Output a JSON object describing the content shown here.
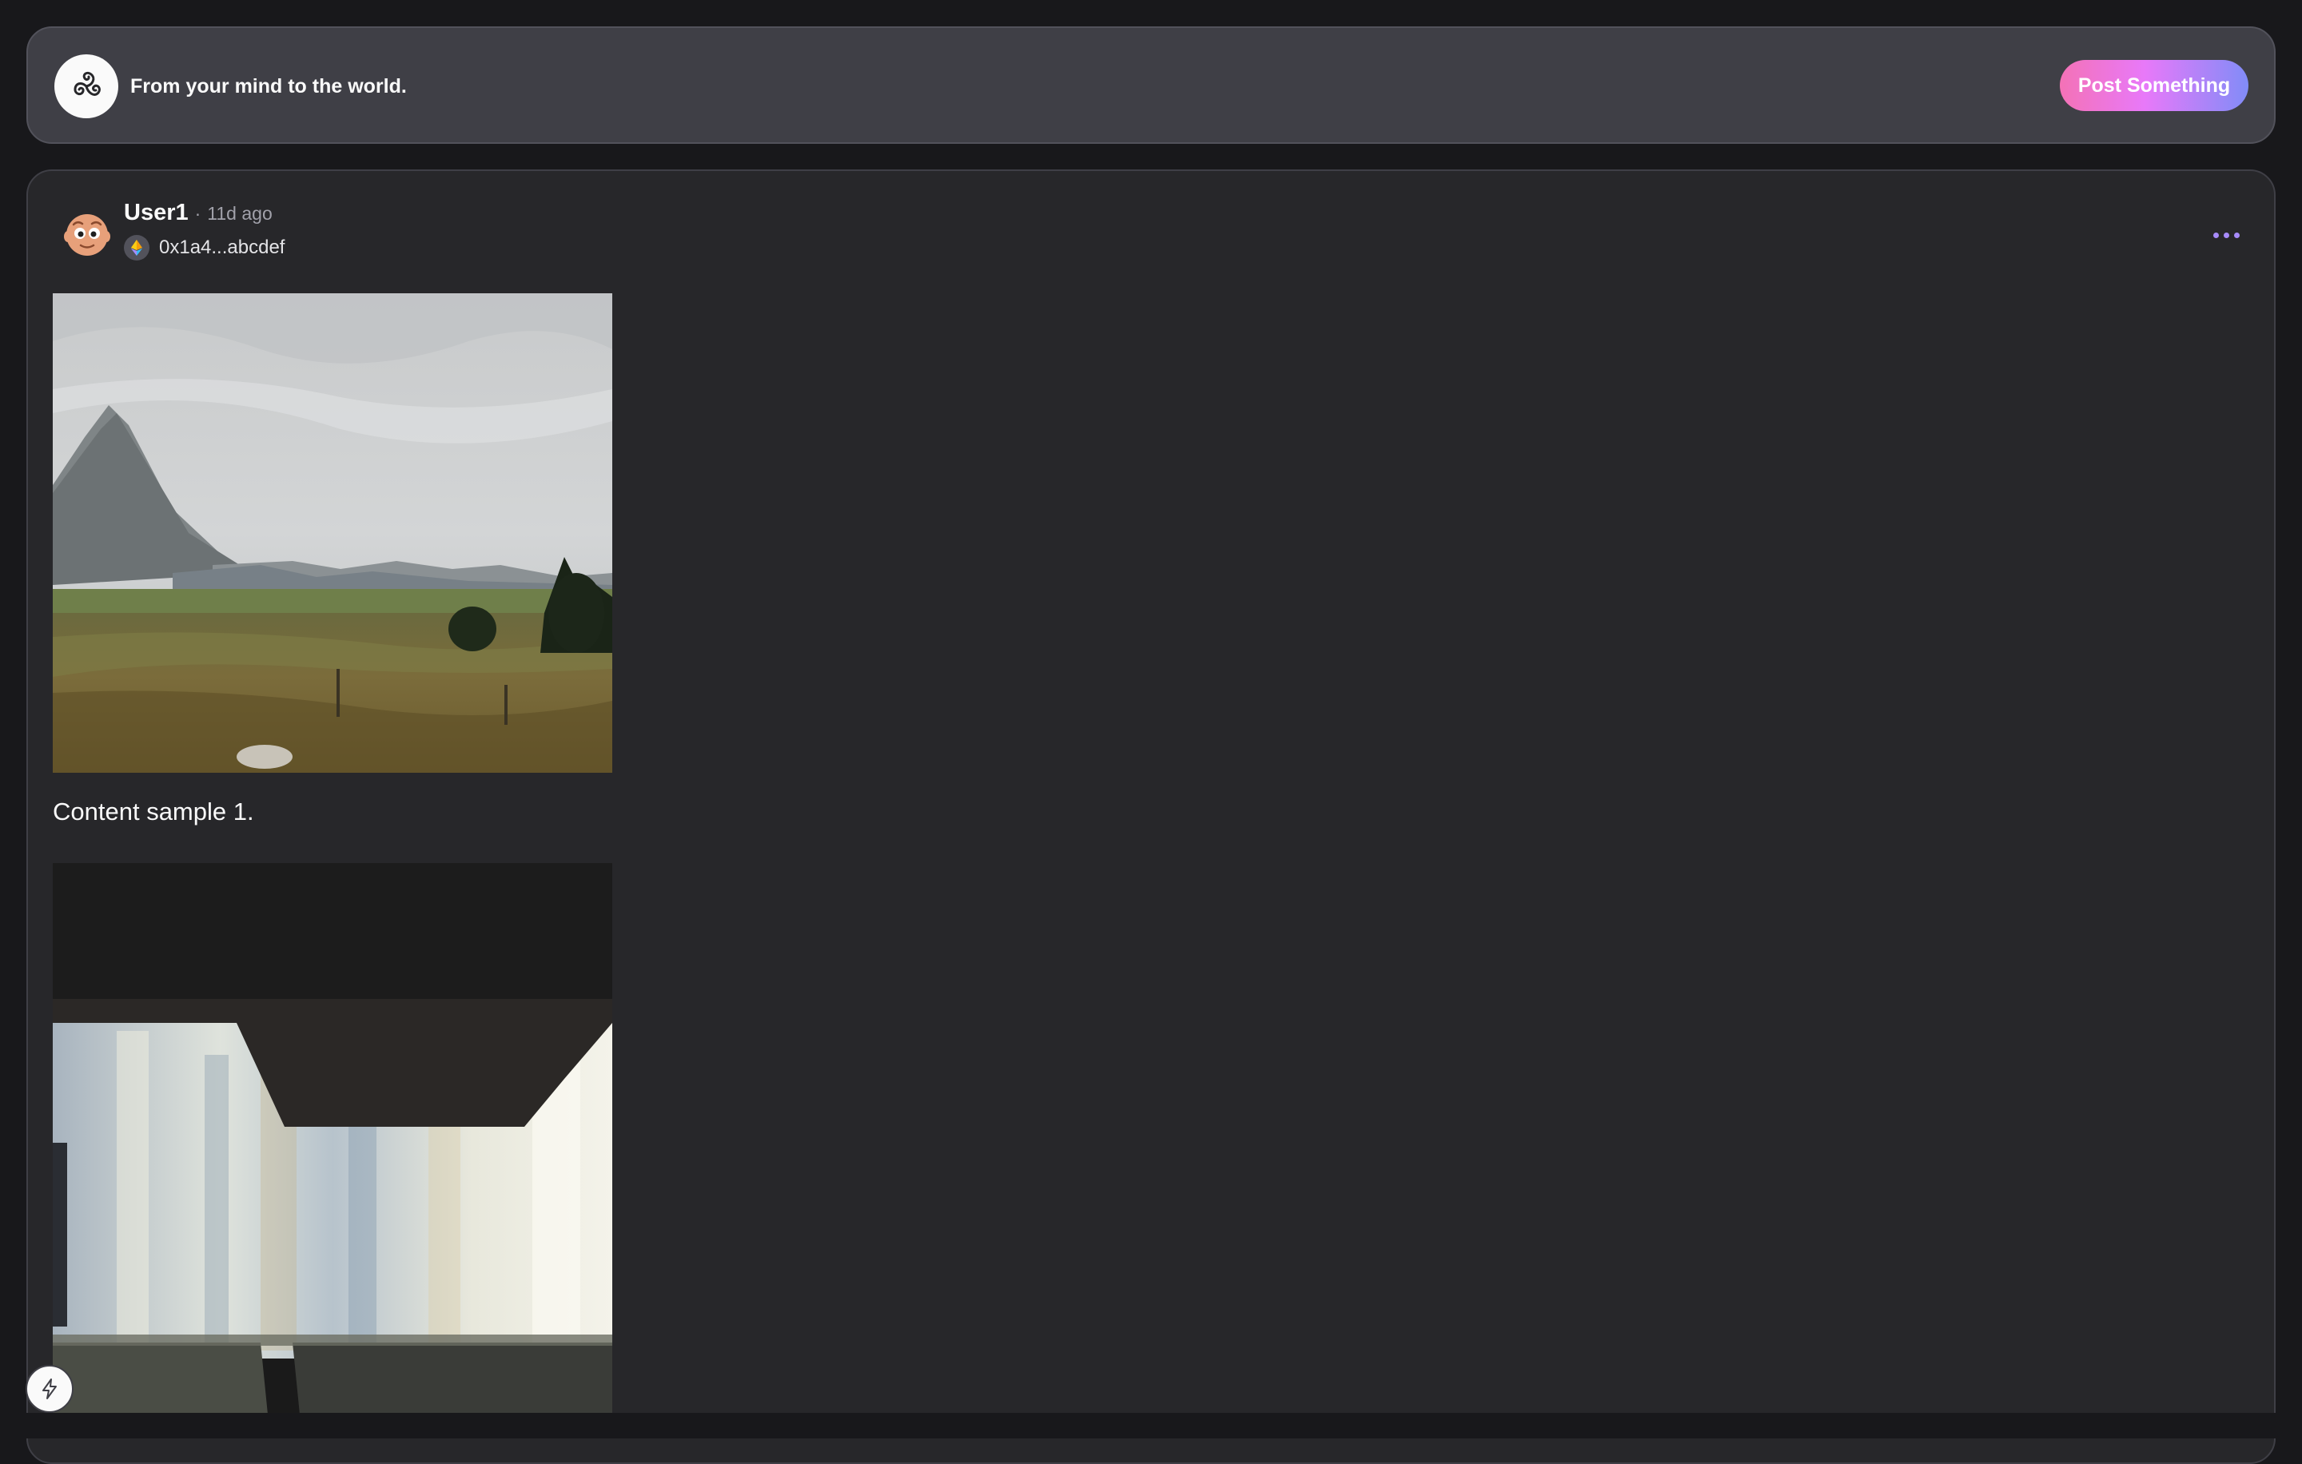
{
  "header": {
    "tagline": "From your mind to the world.",
    "post_button_label": "Post Something",
    "logo_icon": "triskelion-icon"
  },
  "post": {
    "author": "User1",
    "separator": "·",
    "time": "11d ago",
    "wallet_icon": "ethereum-icon",
    "wallet_address": "0x1a4...abcdef",
    "more_icon": "more-horizontal-icon",
    "content": "Content sample 1.",
    "images": [
      {
        "subject": "mountain valley landscape under cloudy sky"
      },
      {
        "subject": "blurry interior with bright windows"
      }
    ]
  },
  "badge": {
    "icon": "lightning-bolt-icon"
  },
  "colors": {
    "background": "#18181b",
    "header_bg": "#3f3f46",
    "card_bg": "#27272a",
    "accent_purple": "#a78bfa",
    "gradient_start": "#f472b6",
    "gradient_end": "#818cf8"
  }
}
